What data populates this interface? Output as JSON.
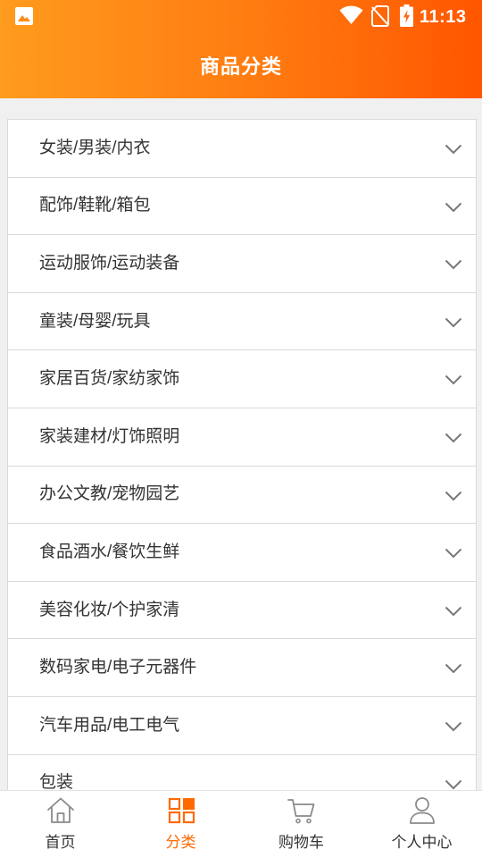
{
  "status_bar": {
    "time": "11:13",
    "icons": [
      "image-notification-icon",
      "wifi-icon",
      "no-sim-icon",
      "battery-charging-icon"
    ]
  },
  "header": {
    "title": "商品分类"
  },
  "categories": [
    {
      "label": "女装/男装/内衣"
    },
    {
      "label": "配饰/鞋靴/箱包"
    },
    {
      "label": "运动服饰/运动装备"
    },
    {
      "label": "童装/母婴/玩具"
    },
    {
      "label": "家居百货/家纺家饰"
    },
    {
      "label": "家装建材/灯饰照明"
    },
    {
      "label": "办公文教/宠物园艺"
    },
    {
      "label": "食品酒水/餐饮生鲜"
    },
    {
      "label": "美容化妆/个护家清"
    },
    {
      "label": "数码家电/电子元器件"
    },
    {
      "label": "汽车用品/电工电气"
    },
    {
      "label": "包装"
    }
  ],
  "nav": [
    {
      "label": "首页",
      "icon": "home-icon",
      "active": false
    },
    {
      "label": "分类",
      "icon": "category-grid-icon",
      "active": true
    },
    {
      "label": "购物车",
      "icon": "cart-icon",
      "active": false
    },
    {
      "label": "个人中心",
      "icon": "person-icon",
      "active": false
    }
  ],
  "colors": {
    "header_gradient_start": "#ff9b1e",
    "header_gradient_end": "#ff5600",
    "active": "#ff6a00",
    "inactive_icon": "#8a8a8a",
    "text": "#333333",
    "background": "#f0f0f0"
  }
}
